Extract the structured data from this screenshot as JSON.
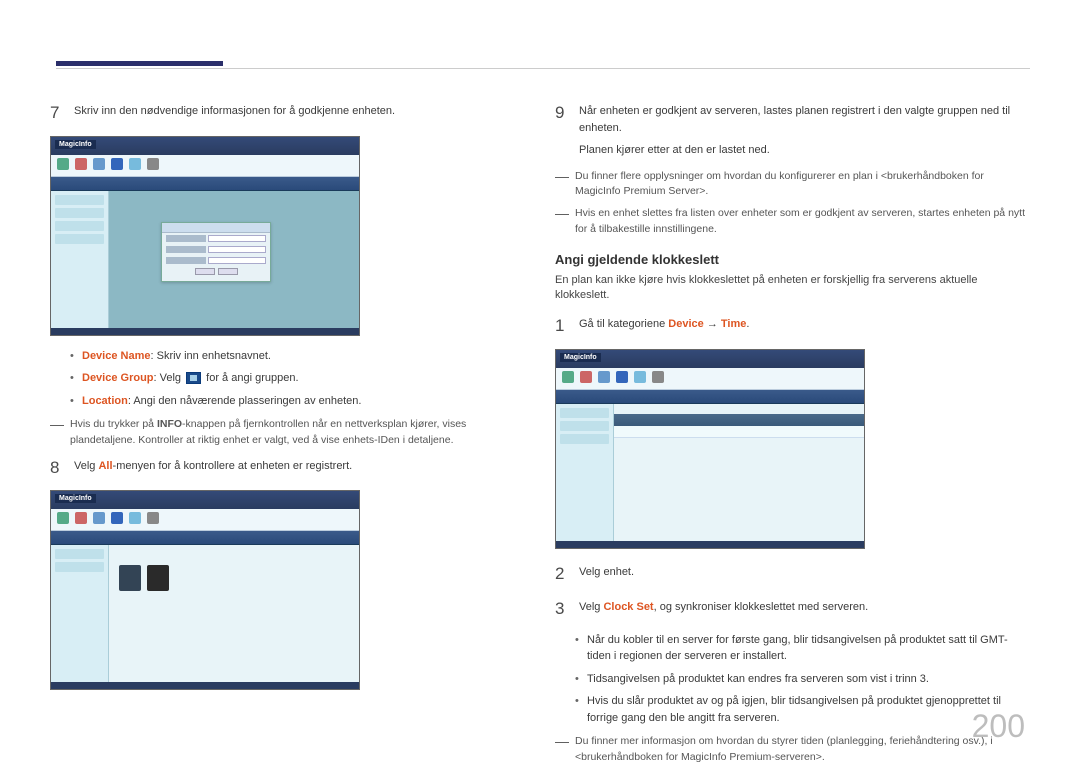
{
  "page_number": "200",
  "left": {
    "step7": "Skriv inn den nødvendige informasjonen for å godkjenne enheten.",
    "bullets": {
      "b1_label": "Device Name",
      "b1_text": ": Skriv inn enhetsnavnet.",
      "b2_label": "Device Group",
      "b2_text_before": ": Velg ",
      "b2_text_after": " for å angi gruppen.",
      "b3_label": "Location",
      "b3_text": ": Angi den nåværende plasseringen av enheten."
    },
    "dash1a": "Hvis du trykker på ",
    "dash1_bold": "INFO",
    "dash1b": "-knappen på fjernkontrollen når en nettverksplan kjører, vises plandetaljene. Kontroller at riktig enhet er valgt, ved å vise enhets-IDen i detaljene.",
    "step8a": "Velg ",
    "step8_em": "All",
    "step8b": "-menyen for å kontrollere at enheten er registrert.",
    "screenshot_label": "MagicInfo"
  },
  "right": {
    "step9a": "Når enheten er godkjent av serveren, lastes planen registrert i den valgte gruppen ned til enheten.",
    "step9b": "Planen kjører etter at den er lastet ned.",
    "dash1": "Du finner flere opplysninger om hvordan du konfigurerer en plan i <brukerhåndboken for MagicInfo Premium Server>.",
    "dash2": "Hvis en enhet slettes fra listen over enheter som er godkjent av serveren, startes enheten på nytt for å tilbakestille innstillingene.",
    "heading": "Angi gjeldende klokkeslett",
    "heading_desc": "En plan kan ikke kjøre hvis klokkeslettet på enheten er forskjellig fra serverens aktuelle klokkeslett.",
    "step1a": "Gå til kategoriene ",
    "step1_em1": "Device",
    "step1_arrow": " → ",
    "step1_em2": "Time",
    "step1b": ".",
    "step2": "Velg enhet.",
    "step3a": "Velg ",
    "step3_em": "Clock Set",
    "step3b": ", og synkroniser klokkeslettet med serveren.",
    "b1": "Når du kobler til en server for første gang, blir tidsangivelsen på produktet satt til GMT-tiden i regionen der serveren er installert.",
    "b2": "Tidsangivelsen på produktet kan endres fra serveren som vist i trinn 3.",
    "b3": "Hvis du slår produktet av og på igjen, blir tidsangivelsen på produktet gjenopprettet til forrige gang den ble angitt fra serveren.",
    "dash3": "Du finner mer informasjon om hvordan du styrer tiden (planlegging, feriehåndtering osv.), i <brukerhåndboken for MagicInfo Premium-serveren>."
  }
}
